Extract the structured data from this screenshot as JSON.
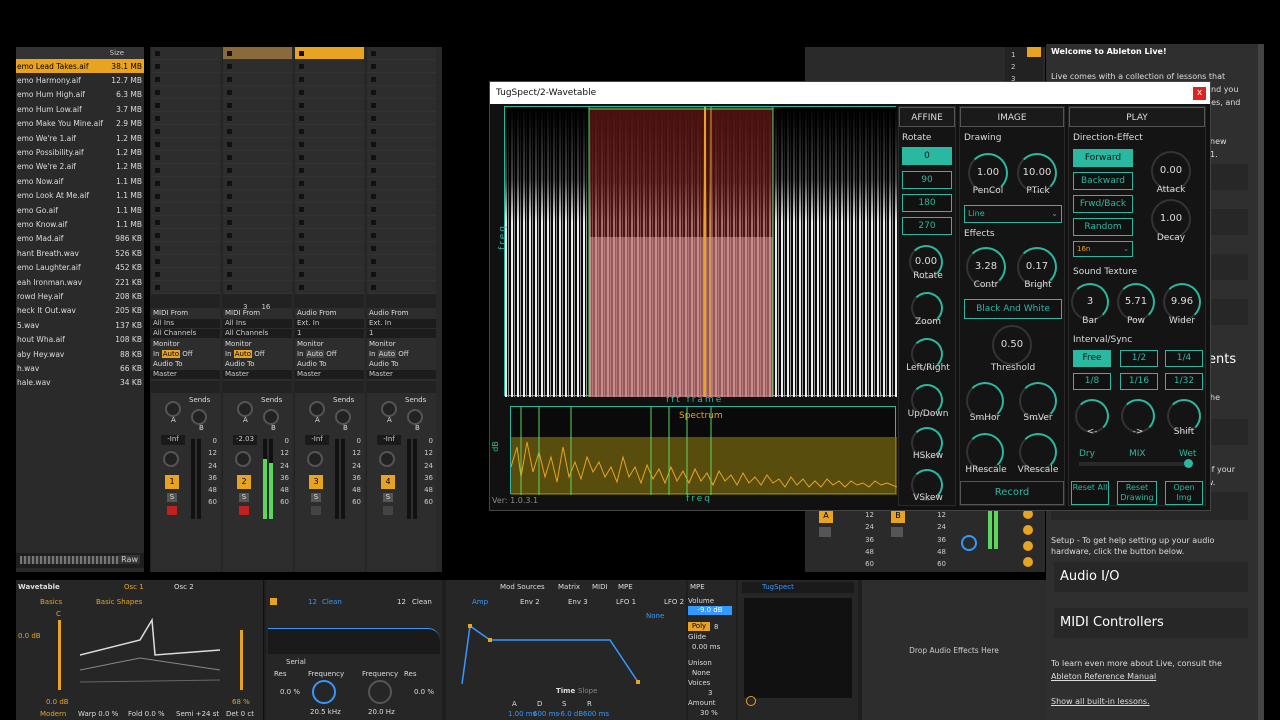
{
  "browser": {
    "size_header": "Size",
    "files": [
      {
        "name": "emo Lead Takes.aif",
        "size": "38.1 MB",
        "selected": true
      },
      {
        "name": "emo Harmony.aif",
        "size": "12.7 MB"
      },
      {
        "name": "emo Hum High.aif",
        "size": "6.3 MB"
      },
      {
        "name": "emo Hum Low.aif",
        "size": "3.7 MB"
      },
      {
        "name": "emo Make You Mine.aif",
        "size": "2.9 MB"
      },
      {
        "name": "emo We're 1.aif",
        "size": "1.2 MB"
      },
      {
        "name": "emo Possibility.aif",
        "size": "1.2 MB"
      },
      {
        "name": "emo We're 2.aif",
        "size": "1.2 MB"
      },
      {
        "name": "emo Now.aif",
        "size": "1.1 MB"
      },
      {
        "name": "emo Look At Me.aif",
        "size": "1.1 MB"
      },
      {
        "name": "emo Go.aif",
        "size": "1.1 MB"
      },
      {
        "name": "emo Know.aif",
        "size": "1.1 MB"
      },
      {
        "name": "emo Mad.aif",
        "size": "986 KB"
      },
      {
        "name": "hant Breath.wav",
        "size": "526 KB"
      },
      {
        "name": "emo Laughter.aif",
        "size": "452 KB"
      },
      {
        "name": "eah Ironman.wav",
        "size": "221 KB"
      },
      {
        "name": "rowd Hey.aif",
        "size": "208 KB"
      },
      {
        "name": "heck It Out.wav",
        "size": "205 KB"
      },
      {
        "name": "5.wav",
        "size": "137 KB"
      },
      {
        "name": "hout Wha.aif",
        "size": "108 KB"
      },
      {
        "name": "aby Hey.wav",
        "size": "88 KB"
      },
      {
        "name": "h.wav",
        "size": "66 KB"
      },
      {
        "name": "hale.wav",
        "size": "34 KB"
      }
    ],
    "raw_label": "Raw"
  },
  "session": {
    "clip_name": "about_time",
    "tracks": [
      {
        "in_label": "MIDI From",
        "in_src": "All Ins",
        "in_ch": "All Channels",
        "num": "1",
        "vol": "-Inf",
        "active": false
      },
      {
        "in_label": "MIDI From",
        "in_src": "All Ins",
        "in_ch": "All Channels",
        "num": "2",
        "vol": "-2.03",
        "active": true
      },
      {
        "in_label": "Audio From",
        "in_src": "Ext. In",
        "in_ch": "1",
        "num": "3",
        "vol": "-Inf",
        "active": false
      },
      {
        "in_label": "Audio From",
        "in_src": "Ext. In",
        "in_ch": "1",
        "num": "4",
        "vol": "-Inf",
        "active": false
      }
    ],
    "monitor": "Monitor",
    "mon_in": "In",
    "mon_auto": "Auto",
    "mon_off": "Off",
    "audio_to": "Audio To",
    "master": "Master",
    "sends": "Sends",
    "send_a": "A",
    "send_b": "B",
    "solo": "S",
    "scale": [
      "0",
      "12",
      "24",
      "36",
      "48",
      "60"
    ],
    "track2_small": "3",
    "track2_small2": "16",
    "right_tracks": [
      "A",
      "B"
    ],
    "right_scale": [
      "12",
      "24",
      "36",
      "48",
      "60"
    ],
    "scene_nums": [
      "1",
      "2",
      "3"
    ]
  },
  "plugin": {
    "title": "TugSpect/2-Wavetable",
    "close": "x",
    "version": "Ver: 1.0.3.1",
    "freq_axis": "freq",
    "fft_axis": "fft frame",
    "db_axis": "dB",
    "spectrum_label": "Spectrum",
    "affine": {
      "header": "AFFINE",
      "rotate_label": "Rotate",
      "angles": [
        "0",
        "90",
        "180",
        "270"
      ],
      "knobs": [
        {
          "value": "0.00",
          "label": "Rotate"
        },
        {
          "label": "Zoom"
        },
        {
          "label": "Left/Right"
        },
        {
          "label": "Up/Down"
        },
        {
          "label": "HSkew"
        },
        {
          "label": "VSkew"
        }
      ]
    },
    "image": {
      "header": "IMAGE",
      "drawing": "Drawing",
      "pencol": "1.00",
      "pencol_label": "PenCol",
      "ptick": "10.00",
      "ptick_label": "PTick",
      "line_select": "Line",
      "effects": "Effects",
      "contr": "3.28",
      "contr_label": "Contr",
      "bright": "0.17",
      "bright_label": "Bright",
      "bw_button": "Black And White",
      "threshold": "0.50",
      "threshold_label": "Threshold",
      "smhor": "SmHor",
      "smver": "SmVer",
      "hrescale": "HRescale",
      "vrescale": "VRescale",
      "record": "Record"
    },
    "play": {
      "header": "PLAY",
      "direction": "Direction-Effect",
      "forward": "Forward",
      "backward": "Backward",
      "frwd_back": "Frwd/Back",
      "random": "Random",
      "attack_val": "0.00",
      "attack": "Attack",
      "decay_val": "1.00",
      "decay": "Decay",
      "rate_select": "16n",
      "sound_texture": "Sound Texture",
      "bar_val": "3",
      "bar": "Bar",
      "pow_val": "5.71",
      "pow": "Pow",
      "wider_val": "9.96",
      "wider": "Wider",
      "interval": "Interval/Sync",
      "intervals": [
        "Free",
        "1/2",
        "1/4",
        "1/8",
        "1/16",
        "1/32"
      ],
      "back": "<-",
      "fwd": "->",
      "shift": "Shift",
      "dry": "Dry",
      "mix": "MIX",
      "wet": "Wet",
      "reset_all": "Reset All",
      "reset_drawing": "Reset Drawing",
      "open_img": "Open Img"
    }
  },
  "help": {
    "welcome": "Welcome to Ableton Live!",
    "intro": "Live comes with a collection of lessons that",
    "frag1": "nd you",
    "frag2": "tes, and",
    "frag3": "new",
    "frag4": "1.",
    "ents": "ents",
    "he": "he",
    "your": "l of your",
    "ow": "ow.",
    "setup": "Setup - To get help setting up your audio hardware, click the button below.",
    "audio_io": "Audio I/O",
    "midi_ctrl": "MIDI Controllers",
    "learn": "To learn even more about Live, consult the",
    "manual": "Ableton Reference Manual",
    "show": "Show all built-in lessons."
  },
  "device": {
    "name": "Wavetable",
    "osc1": "Osc 1",
    "osc2": "Osc 2",
    "basics": "Basics",
    "basic_shapes": "Basic Shapes",
    "c_label": "C",
    "db0": "0.0 dB",
    "db0b": "0.0 dB",
    "pct68": "68 %",
    "modern": "Modern",
    "warp": "Warp 0.0 %",
    "fold": "Fold 0.0 %",
    "semi": "Semi +24 st",
    "det": "Det 0 ct",
    "filter1": "Clean",
    "filter2": "Clean",
    "f12": "12",
    "f12b": "12",
    "serial": "Serial",
    "res": "Res",
    "res_val": "0.0 %",
    "freq": "Frequency",
    "freq_val": "20.5 kHz",
    "freq2": "Frequency",
    "freq2_val": "20.0 Hz",
    "res2": "Res",
    "res2_val": "0.0 %",
    "mod_tabs": [
      "Mod Sources",
      "Matrix",
      "MIDI",
      "MPE"
    ],
    "env_tabs": [
      "Amp",
      "Env 2",
      "Env 3",
      "LFO 1",
      "LFO 2"
    ],
    "none": "None",
    "time": "Time",
    "slope": "Slope",
    "adsr": [
      "A",
      "D",
      "S",
      "R"
    ],
    "adsr_vals": [
      "1.00 ms",
      "600 ms",
      "-6.0 dB",
      "600 ms"
    ],
    "mpe": "MPE",
    "volume": "Volume",
    "vol_val": "-9.0 dB",
    "poly": "Poly",
    "poly_val": "8",
    "glide": "Glide",
    "glide_val": "0.00 ms",
    "unison": "Unison",
    "unison_val": "None",
    "voices": "Voices",
    "voices_val": "3",
    "amount": "Amount",
    "amount_val": "30 %",
    "tug_name": "TugSpect",
    "drop": "Drop Audio Effects Here"
  },
  "colors": {
    "accent": "#e8a320",
    "teal": "#2bb8a0",
    "green": "#5cd65c"
  }
}
